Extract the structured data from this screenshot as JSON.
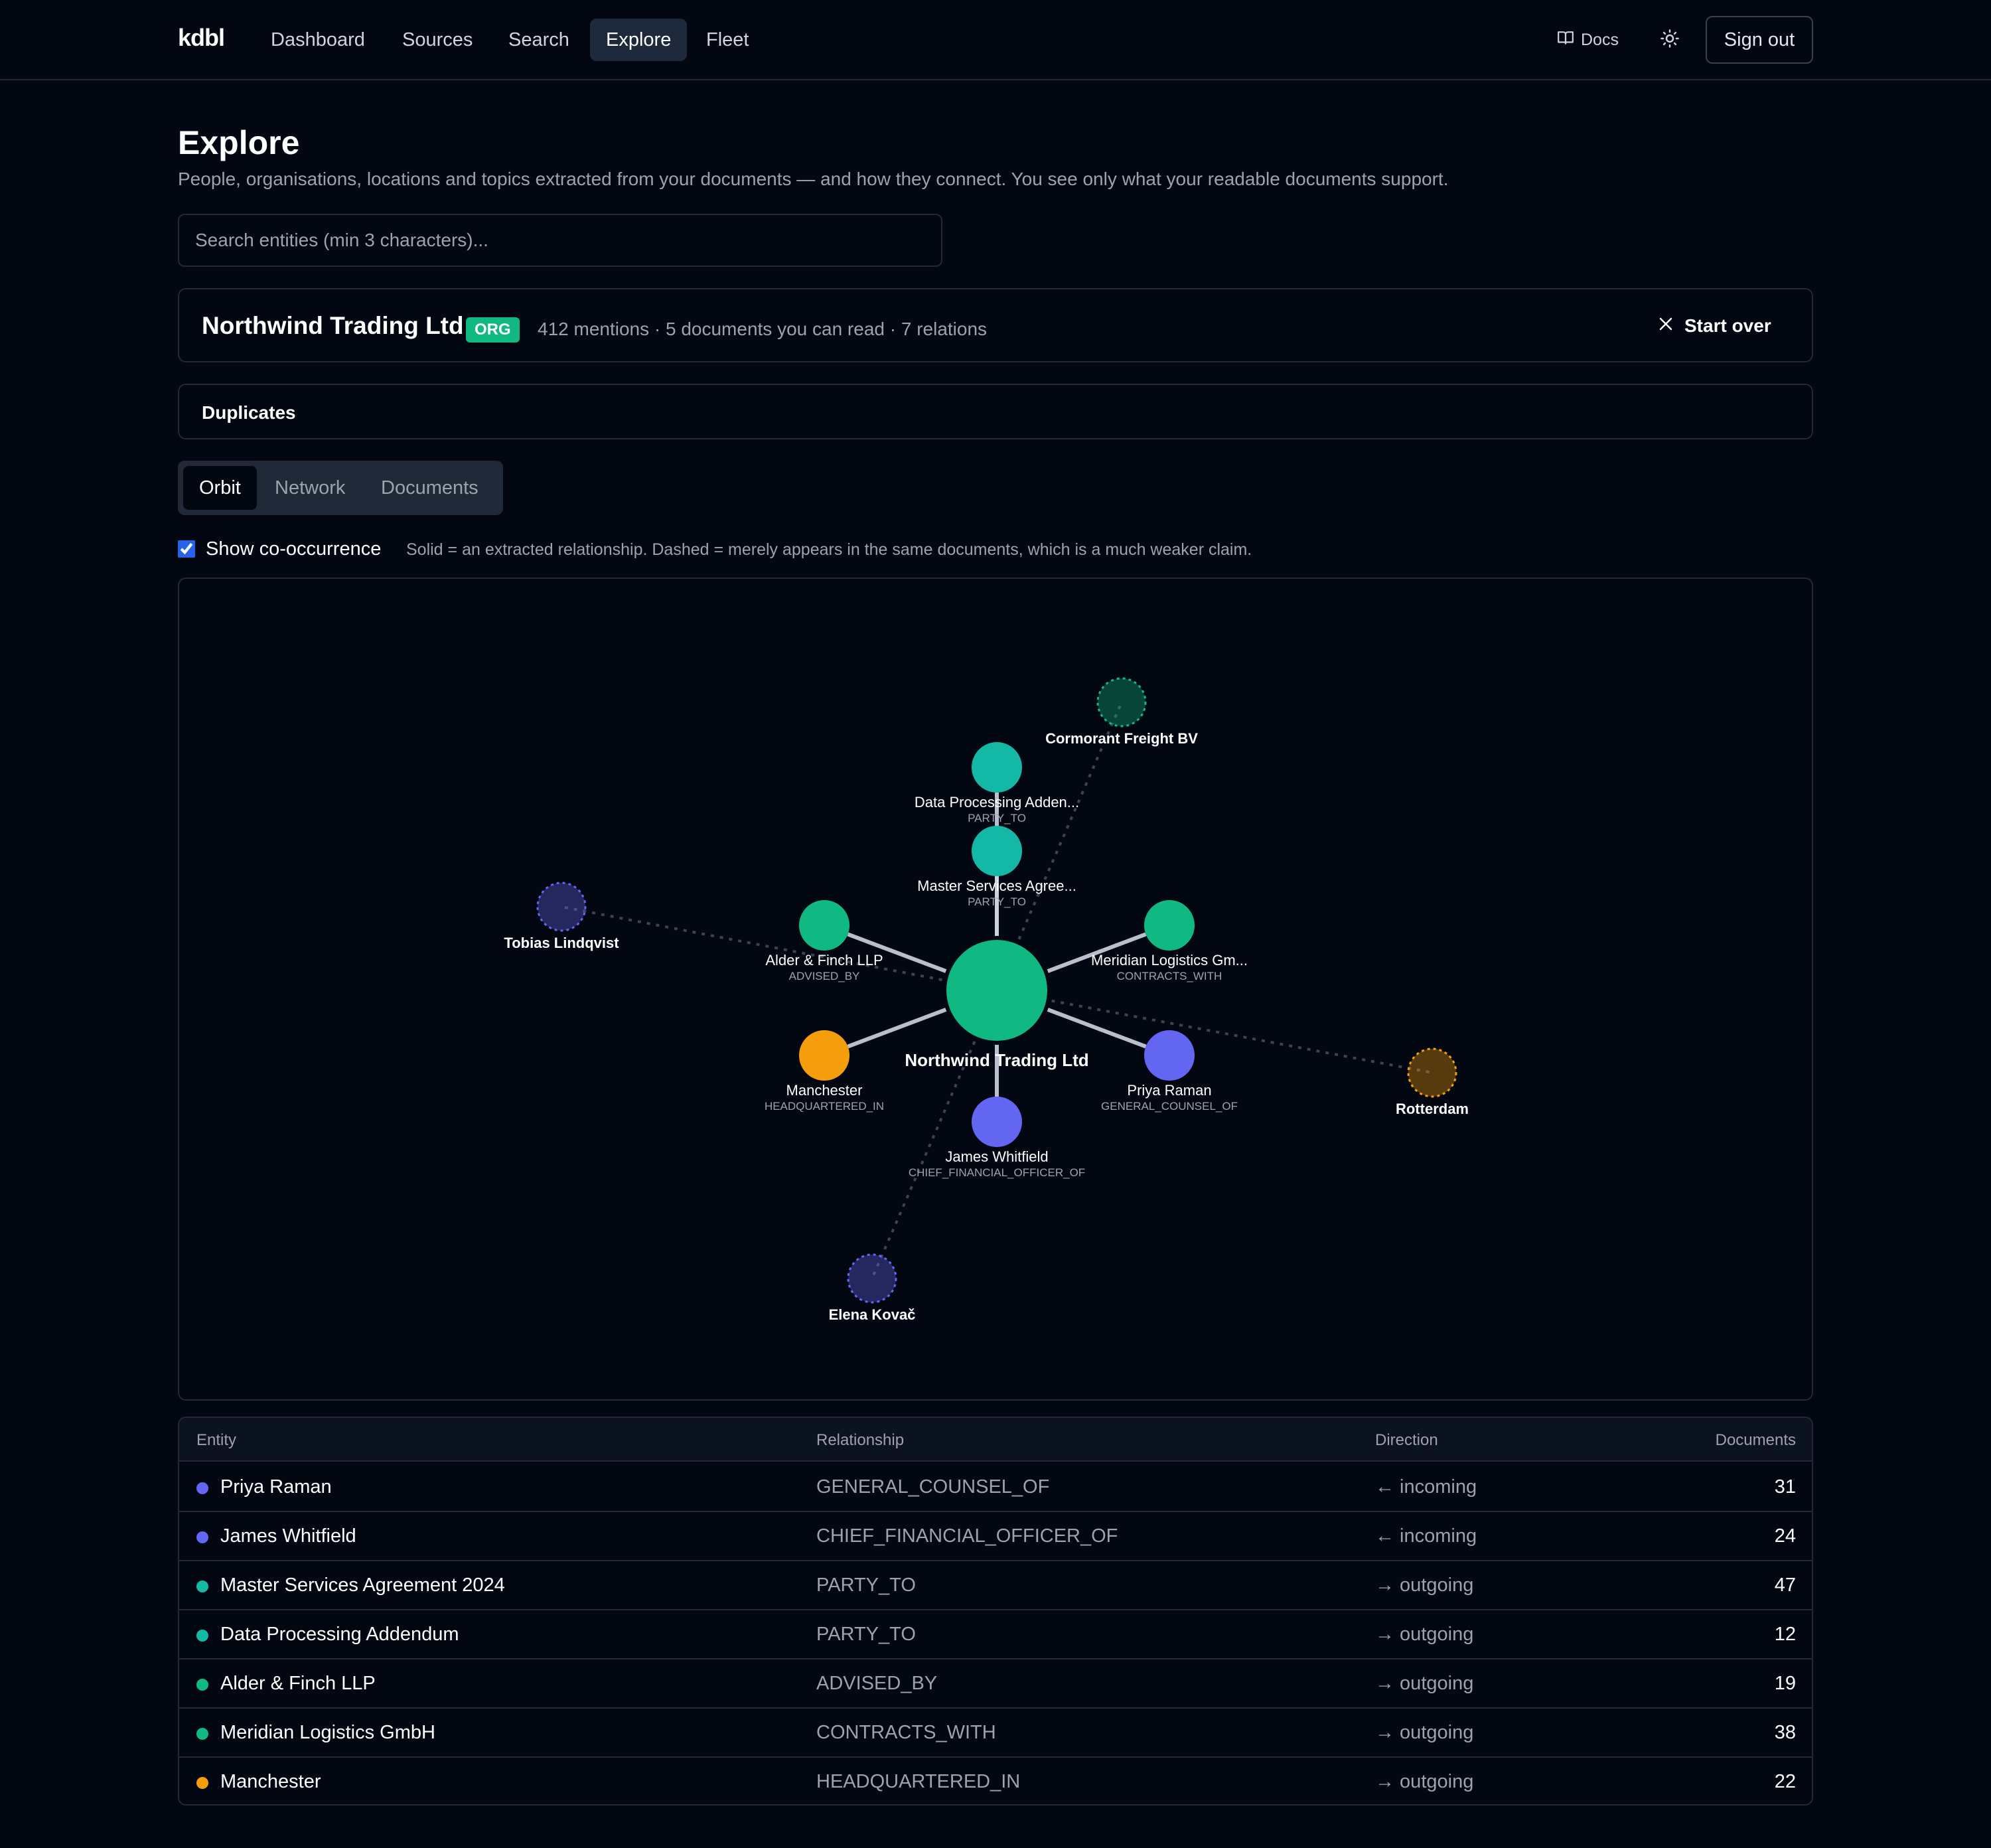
{
  "app": {
    "brand": "kdbl",
    "nav": [
      "Dashboard",
      "Sources",
      "Search",
      "Explore",
      "Fleet"
    ],
    "active_nav": "Explore",
    "docs_label": "Docs",
    "signout_label": "Sign out"
  },
  "page": {
    "title": "Explore",
    "subtitle": "People, organisations, locations and topics extracted from your documents — and how they connect. You see only what your readable documents support."
  },
  "search": {
    "placeholder": "Search entities (min 3 characters)...",
    "value": ""
  },
  "entity": {
    "name": "Northwind Trading Ltd",
    "type_badge": "ORG",
    "stats": "412 mentions · 5 documents you can read · 7 relations",
    "start_over_label": "Start over"
  },
  "duplicates": {
    "title": "Duplicates"
  },
  "tabs": {
    "items": [
      "Orbit",
      "Network",
      "Documents"
    ],
    "active": "Orbit"
  },
  "cooccurrence": {
    "label": "Show co-occurrence",
    "checked": true,
    "note": "Solid = an extracted relationship. Dashed = merely appears in the same documents, which is a much weaker claim."
  },
  "colors": {
    "org": "#10b981",
    "document": "#14b8a6",
    "person": "#6366f1",
    "location": "#f59e0b",
    "edge": "#cbd5e1"
  },
  "graph": {
    "center": {
      "label": "Northwind Trading Ltd",
      "kind": "org"
    },
    "related": [
      {
        "label": "Data Processing Adden...",
        "sublabel": "PARTY_TO",
        "kind": "document"
      },
      {
        "label": "Master Services Agree...",
        "sublabel": "PARTY_TO",
        "kind": "document"
      },
      {
        "label": "Alder & Finch LLP",
        "sublabel": "ADVISED_BY",
        "kind": "org"
      },
      {
        "label": "Meridian Logistics Gm...",
        "sublabel": "CONTRACTS_WITH",
        "kind": "org"
      },
      {
        "label": "Manchester",
        "sublabel": "HEADQUARTERED_IN",
        "kind": "location"
      },
      {
        "label": "Priya Raman",
        "sublabel": "GENERAL_COUNSEL_OF",
        "kind": "person"
      },
      {
        "label": "James Whitfield",
        "sublabel": "CHIEF_FINANCIAL_OFFICER_OF",
        "kind": "person"
      }
    ],
    "cooccurrence": [
      {
        "label": "Cormorant Freight BV",
        "kind": "org"
      },
      {
        "label": "Tobias Lindqvist",
        "kind": "person"
      },
      {
        "label": "Rotterdam",
        "kind": "location"
      },
      {
        "label": "Elena Kovač",
        "kind": "person"
      }
    ]
  },
  "table": {
    "headers": {
      "entity": "Entity",
      "relationship": "Relationship",
      "direction": "Direction",
      "documents": "Documents"
    },
    "rows": [
      {
        "entity": "Priya Raman",
        "kind": "person",
        "relationship": "GENERAL_COUNSEL_OF",
        "direction": "← incoming",
        "documents": "31"
      },
      {
        "entity": "James Whitfield",
        "kind": "person",
        "relationship": "CHIEF_FINANCIAL_OFFICER_OF",
        "direction": "← incoming",
        "documents": "24"
      },
      {
        "entity": "Master Services Agreement 2024",
        "kind": "document",
        "relationship": "PARTY_TO",
        "direction": "→ outgoing",
        "documents": "47"
      },
      {
        "entity": "Data Processing Addendum",
        "kind": "document",
        "relationship": "PARTY_TO",
        "direction": "→ outgoing",
        "documents": "12"
      },
      {
        "entity": "Alder & Finch LLP",
        "kind": "org",
        "relationship": "ADVISED_BY",
        "direction": "→ outgoing",
        "documents": "19"
      },
      {
        "entity": "Meridian Logistics GmbH",
        "kind": "org",
        "relationship": "CONTRACTS_WITH",
        "direction": "→ outgoing",
        "documents": "38"
      },
      {
        "entity": "Manchester",
        "kind": "location",
        "relationship": "HEADQUARTERED_IN",
        "direction": "→ outgoing",
        "documents": "22"
      }
    ]
  }
}
